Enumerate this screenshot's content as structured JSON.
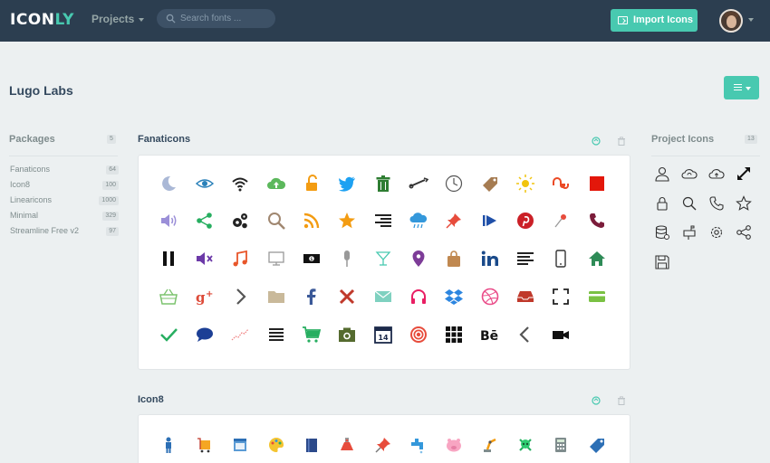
{
  "app": {
    "logo_main": "ICON",
    "logo_accent": "LY",
    "nav_projects": "Projects",
    "search_placeholder": "Search fonts ...",
    "import_label": "Import Icons"
  },
  "page": {
    "title": "Lugo Labs"
  },
  "sidebar": {
    "title": "Packages",
    "count": "5",
    "items": [
      {
        "label": "Fanaticons",
        "count": "64"
      },
      {
        "label": "Icon8",
        "count": "100"
      },
      {
        "label": "Linearicons",
        "count": "1000"
      },
      {
        "label": "Minimal",
        "count": "329"
      },
      {
        "label": "Streamline Free v2",
        "count": "97"
      }
    ]
  },
  "sections": [
    {
      "title": "Fanaticons"
    },
    {
      "title": "Icon8"
    }
  ],
  "project": {
    "title": "Project Icons",
    "count": "13"
  },
  "colors": {
    "topbar": "#2c3e50",
    "accent": "#48c9b0",
    "background": "#ecf0f1"
  },
  "fanaticons_icons": [
    "moon-icon",
    "eye-icon",
    "wifi-icon",
    "cloud-upload-icon",
    "unlock-icon",
    "twitter-icon",
    "trash-icon",
    "wrench-icon",
    "clock-icon",
    "tag-icon",
    "sun-icon",
    "stumbleupon-icon",
    "square-icon",
    "volume-icon",
    "share-icon",
    "gears-icon",
    "search-icon",
    "rss-icon",
    "star-icon",
    "align-right-icon",
    "cloud-rain-icon",
    "pin-icon",
    "play-next-icon",
    "pinterest-icon",
    "pushpin-icon",
    "phone-icon",
    "pause-icon",
    "mute-icon",
    "music-icon",
    "monitor-icon",
    "money-icon",
    "microphone-icon",
    "martini-icon",
    "map-marker-icon",
    "bag-icon",
    "linkedin-icon",
    "align-left-icon",
    "mobile-icon",
    "home-icon",
    "basket-icon",
    "google-plus-icon",
    "chevron-right-icon",
    "folder-icon",
    "facebook-icon",
    "close-icon",
    "mail-icon",
    "headphones-icon",
    "dropbox-icon",
    "dribbble-icon",
    "inbox-icon",
    "fullscreen-icon",
    "card-icon",
    "check-icon",
    "chat-icon",
    "chart-line-icon",
    "menu-icon",
    "cart-icon",
    "camera-icon",
    "calendar-icon",
    "target-icon",
    "grid-icon",
    "behance-icon",
    "chevron-left-icon",
    "video-icon"
  ],
  "icon8_icons": [
    "person-icon",
    "cart-yellow-icon",
    "calendar-window-icon",
    "palette-icon",
    "book-icon",
    "potion-icon",
    "pushpin-red-icon",
    "faucet-icon",
    "pig-icon",
    "robot-arm-icon",
    "skull-icon",
    "calculator-icon",
    "price-tag-icon"
  ],
  "project_icons": [
    "user-icon",
    "cloud-sync-icon",
    "cloud-upload-outline-icon",
    "resize-icon",
    "lock-icon",
    "search-outline-icon",
    "phone-outline-icon",
    "star-outline-icon",
    "database-icon",
    "mailbox-icon",
    "settings-icon",
    "share-outline-icon",
    "floppy-icon"
  ]
}
